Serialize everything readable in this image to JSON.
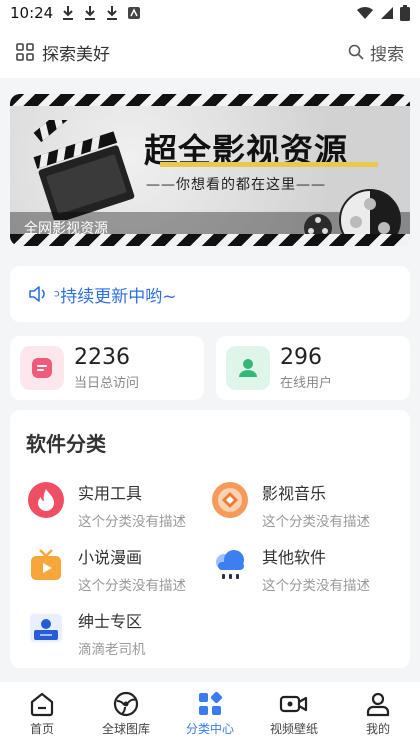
{
  "status_bar": {
    "time": "10:24"
  },
  "header": {
    "title": "探索美好",
    "search_label": "搜索"
  },
  "banner": {
    "headline": "超全影视资源",
    "subline": "——你想看的都在这里——",
    "caption": "全网影视资源"
  },
  "notice": {
    "text": "ᵓ持续更新中哟~"
  },
  "stats": [
    {
      "value": "2236",
      "label": "当日总访问",
      "icon": "document-icon",
      "color": "#f25a7b",
      "bg": "#fde7ec"
    },
    {
      "value": "296",
      "label": "在线用户",
      "icon": "user-icon",
      "color": "#34b87a",
      "bg": "#dff5ea"
    }
  ],
  "category": {
    "heading": "软件分类",
    "items": [
      {
        "name": "实用工具",
        "desc": "这个分类没有描述",
        "icon": "flame-icon"
      },
      {
        "name": "影视音乐",
        "desc": "这个分类没有描述",
        "icon": "diamond-icon"
      },
      {
        "name": "小说漫画",
        "desc": "这个分类没有描述",
        "icon": "tv-play-icon"
      },
      {
        "name": "其他软件",
        "desc": "这个分类没有描述",
        "icon": "cloud-icon"
      },
      {
        "name": "绅士专区",
        "desc": "滴滴老司机",
        "icon": "laptop-person-icon"
      }
    ]
  },
  "tabbar": {
    "active": "分类中心",
    "tabs": [
      {
        "label": "首页",
        "icon": "home-icon"
      },
      {
        "label": "全球图库",
        "icon": "globe-icon"
      },
      {
        "label": "分类中心",
        "icon": "grid-icon"
      },
      {
        "label": "视频壁纸",
        "icon": "video-camera-icon"
      },
      {
        "label": "我的",
        "icon": "person-icon"
      }
    ]
  },
  "colors": {
    "accent": "#3a7bef",
    "notice": "#2f6fe4",
    "background": "#f4f5f7"
  }
}
